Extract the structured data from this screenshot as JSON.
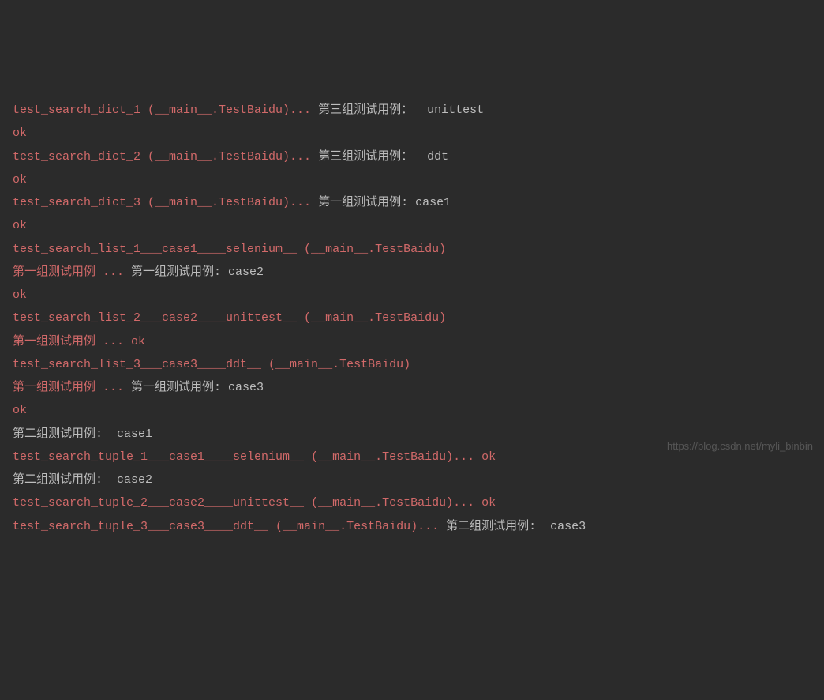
{
  "lines": [
    {
      "segments": [
        {
          "cls": "red",
          "text": "test_search_dict_1 (__main__.TestBaidu)... "
        },
        {
          "cls": "gray",
          "text": "第三组测试用例：  unittest"
        }
      ]
    },
    {
      "segments": [
        {
          "cls": "red",
          "text": "ok"
        }
      ]
    },
    {
      "segments": [
        {
          "cls": "red",
          "text": "test_search_dict_2 (__main__.TestBaidu)... "
        },
        {
          "cls": "gray",
          "text": "第三组测试用例：  ddt"
        }
      ]
    },
    {
      "segments": [
        {
          "cls": "red",
          "text": "ok"
        }
      ]
    },
    {
      "segments": [
        {
          "cls": "red",
          "text": "test_search_dict_3 (__main__.TestBaidu)... "
        },
        {
          "cls": "gray",
          "text": "第一组测试用例: case1"
        }
      ]
    },
    {
      "segments": [
        {
          "cls": "red",
          "text": "ok"
        }
      ]
    },
    {
      "segments": [
        {
          "cls": "red",
          "text": "test_search_list_1___case1____selenium__ (__main__.TestBaidu)"
        }
      ]
    },
    {
      "segments": [
        {
          "cls": "red",
          "text": "第一组测试用例 ... "
        },
        {
          "cls": "gray",
          "text": "第一组测试用例: case2"
        }
      ]
    },
    {
      "segments": [
        {
          "cls": "red",
          "text": "ok"
        }
      ]
    },
    {
      "segments": [
        {
          "cls": "red",
          "text": "test_search_list_2___case2____unittest__ (__main__.TestBaidu)"
        }
      ]
    },
    {
      "segments": [
        {
          "cls": "red",
          "text": "第一组测试用例 ... ok"
        }
      ]
    },
    {
      "segments": [
        {
          "cls": "red",
          "text": "test_search_list_3___case3____ddt__ (__main__.TestBaidu)"
        }
      ]
    },
    {
      "segments": [
        {
          "cls": "red",
          "text": "第一组测试用例 ... "
        },
        {
          "cls": "gray",
          "text": "第一组测试用例: case3"
        }
      ]
    },
    {
      "segments": [
        {
          "cls": "red",
          "text": "ok"
        }
      ]
    },
    {
      "segments": [
        {
          "cls": "gray",
          "text": "第二组测试用例:  case1"
        }
      ]
    },
    {
      "segments": [
        {
          "cls": "red",
          "text": "test_search_tuple_1___case1____selenium__ (__main__.TestBaidu)... ok"
        }
      ]
    },
    {
      "segments": [
        {
          "cls": "gray",
          "text": "第二组测试用例:  case2"
        }
      ]
    },
    {
      "segments": [
        {
          "cls": "red",
          "text": "test_search_tuple_2___case2____unittest__ (__main__.TestBaidu)... ok"
        }
      ]
    },
    {
      "segments": [
        {
          "cls": "red",
          "text": "test_search_tuple_3___case3____ddt__ (__main__.TestBaidu)... "
        },
        {
          "cls": "gray",
          "text": "第二组测试用例:  case3"
        }
      ]
    }
  ],
  "watermark": "https://blog.csdn.net/myli_binbin"
}
